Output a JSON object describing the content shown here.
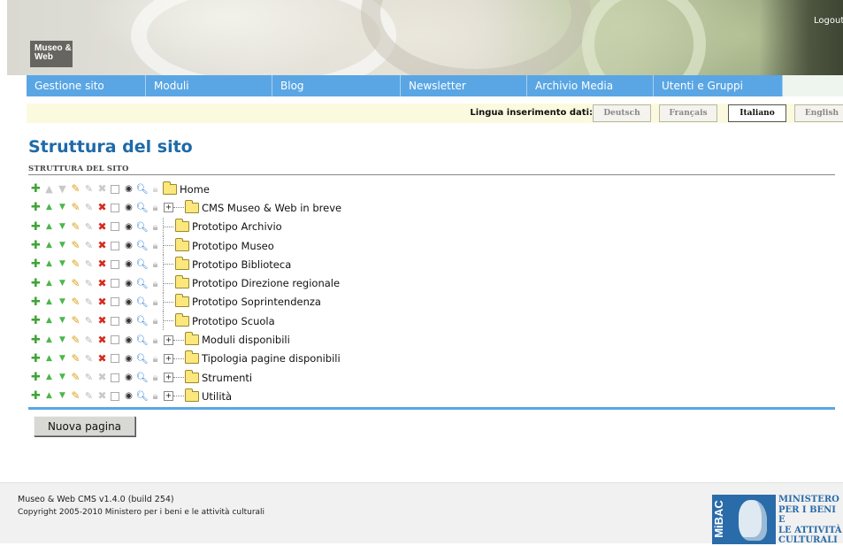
{
  "header": {
    "logo_text": "Museo & Web",
    "logout_label": "Logout"
  },
  "nav": {
    "tabs": [
      "Gestione sito",
      "Moduli",
      "Blog",
      "Newsletter",
      "Archivio Media",
      "Utenti e Gruppi"
    ]
  },
  "language": {
    "label": "Lingua inserimento dati:",
    "options": [
      "Deutsch",
      "Français",
      "Italiano",
      "English"
    ],
    "selected": "Italiano"
  },
  "content": {
    "page_title": "Struttura del sito",
    "section_label": "STRUTTURA DEL SITO",
    "new_page_button": "Nuova pagina"
  },
  "tree": {
    "root": "Home",
    "items": [
      {
        "label": "CMS Museo & Web in breve",
        "expandable": true,
        "can_delete": true
      },
      {
        "label": "Prototipo Archivio",
        "expandable": false,
        "can_delete": true
      },
      {
        "label": "Prototipo Museo",
        "expandable": false,
        "can_delete": true
      },
      {
        "label": "Prototipo Biblioteca",
        "expandable": false,
        "can_delete": true
      },
      {
        "label": "Prototipo Direzione regionale",
        "expandable": false,
        "can_delete": true
      },
      {
        "label": "Prototipo Soprintendenza",
        "expandable": false,
        "can_delete": true
      },
      {
        "label": "Prototipo Scuola",
        "expandable": false,
        "can_delete": true
      },
      {
        "label": "Moduli disponibili",
        "expandable": true,
        "can_delete": true
      },
      {
        "label": "Tipologia pagine disponibili",
        "expandable": true,
        "can_delete": true
      },
      {
        "label": "Strumenti",
        "expandable": true,
        "can_delete": false
      },
      {
        "label": "Utilità",
        "expandable": true,
        "can_delete": false
      }
    ]
  },
  "footer": {
    "version": "Museo & Web CMS v1.4.0 (build 254)",
    "copyright": "Copyright 2005-2010 Ministero per i beni e le attività culturali",
    "emblem_text": "MiBAC",
    "ministry_lines": [
      "MINISTERO",
      "PER I BENI E",
      "LE ATTIVITÀ",
      "CULTURALI"
    ]
  },
  "colors": {
    "nav": "#5aa6e4",
    "title": "#1e6aa8",
    "langbar": "#fbfadf",
    "ministry": "#2a6ca9"
  }
}
